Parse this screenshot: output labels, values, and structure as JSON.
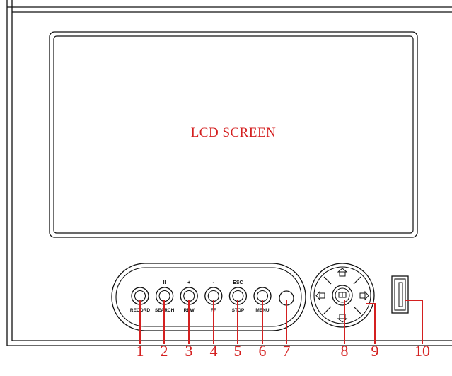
{
  "lcd": {
    "label": "LCD SCREEN"
  },
  "buttons": [
    {
      "id": "record",
      "label": "RECORD",
      "top": ""
    },
    {
      "id": "search",
      "label": "SEARCH",
      "top": "II"
    },
    {
      "id": "rew",
      "label": "REW",
      "top": "+"
    },
    {
      "id": "ff",
      "label": "FF",
      "top": "-"
    },
    {
      "id": "stop",
      "label": "STOP",
      "top": "ESC"
    },
    {
      "id": "menu",
      "label": "MENU",
      "top": ""
    }
  ],
  "callouts": [
    "1",
    "2",
    "3",
    "4",
    "5",
    "6",
    "7",
    "8",
    "9",
    "10"
  ],
  "colors": {
    "callout": "#d42020",
    "outline": "#111111"
  }
}
